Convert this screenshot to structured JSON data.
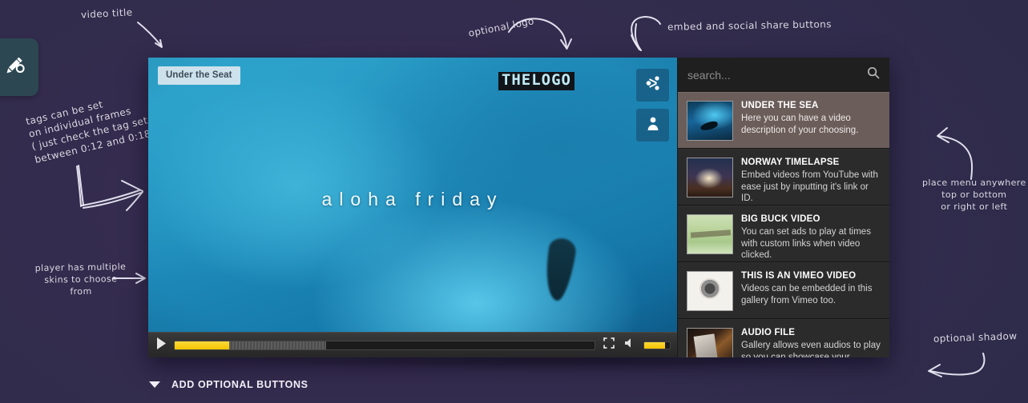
{
  "annotations": {
    "video_title": "video title",
    "tags": "tags can be set\non individual frames\n( just check the tag set\nbetween 0:12 and 0:18 )",
    "skins": "player has multiple\nskins to choose\nfrom",
    "logo": "optional logo",
    "embed_share": "embed and social share buttons",
    "menu_placement": "place menu anywhere\ntop or bottom\nor right or left",
    "shadow": "optional shadow"
  },
  "edit_tab": {
    "icon": "pencil-gear-icon"
  },
  "player": {
    "video_title_badge": "Under the Seat",
    "logo_text": "THELOGO",
    "caption": "aloha friday",
    "buttons": {
      "share": "share-icon",
      "embed": "person-icon"
    },
    "controls": {
      "play": "play-icon",
      "fullscreen": "fullscreen-icon",
      "mute": "speaker-icon",
      "played_percent": 13,
      "buffered_percent": 36,
      "volume_percent": 82,
      "accent_color": "#f5c400"
    }
  },
  "playlist": {
    "search_placeholder": "search...",
    "search_value": "",
    "search_icon": "magnifier-icon",
    "items": [
      {
        "title": "UNDER THE SEA",
        "description": "Here you can have a video description of your choosing.",
        "thumb": "t-sea",
        "active": true
      },
      {
        "title": "NORWAY TIMELAPSE",
        "description": "Embed videos from YouTube with ease just by inputting it's link or ID.",
        "thumb": "t-norway",
        "active": false
      },
      {
        "title": "BIG BUCK VIDEO",
        "description": "You can set ads to play at times with custom links when video clicked.",
        "thumb": "t-buck",
        "active": false
      },
      {
        "title": "THIS IS AN VIMEO VIDEO",
        "description": "Videos can be embedded in this gallery from Vimeo too.",
        "thumb": "t-vimeo",
        "active": false
      },
      {
        "title": "AUDIO FILE",
        "description": "Gallery allows even audios to play so you can showcase your albums.",
        "thumb": "t-audio",
        "active": false
      }
    ]
  },
  "footer": {
    "add_optional_buttons": "ADD OPTIONAL BUTTONS"
  }
}
